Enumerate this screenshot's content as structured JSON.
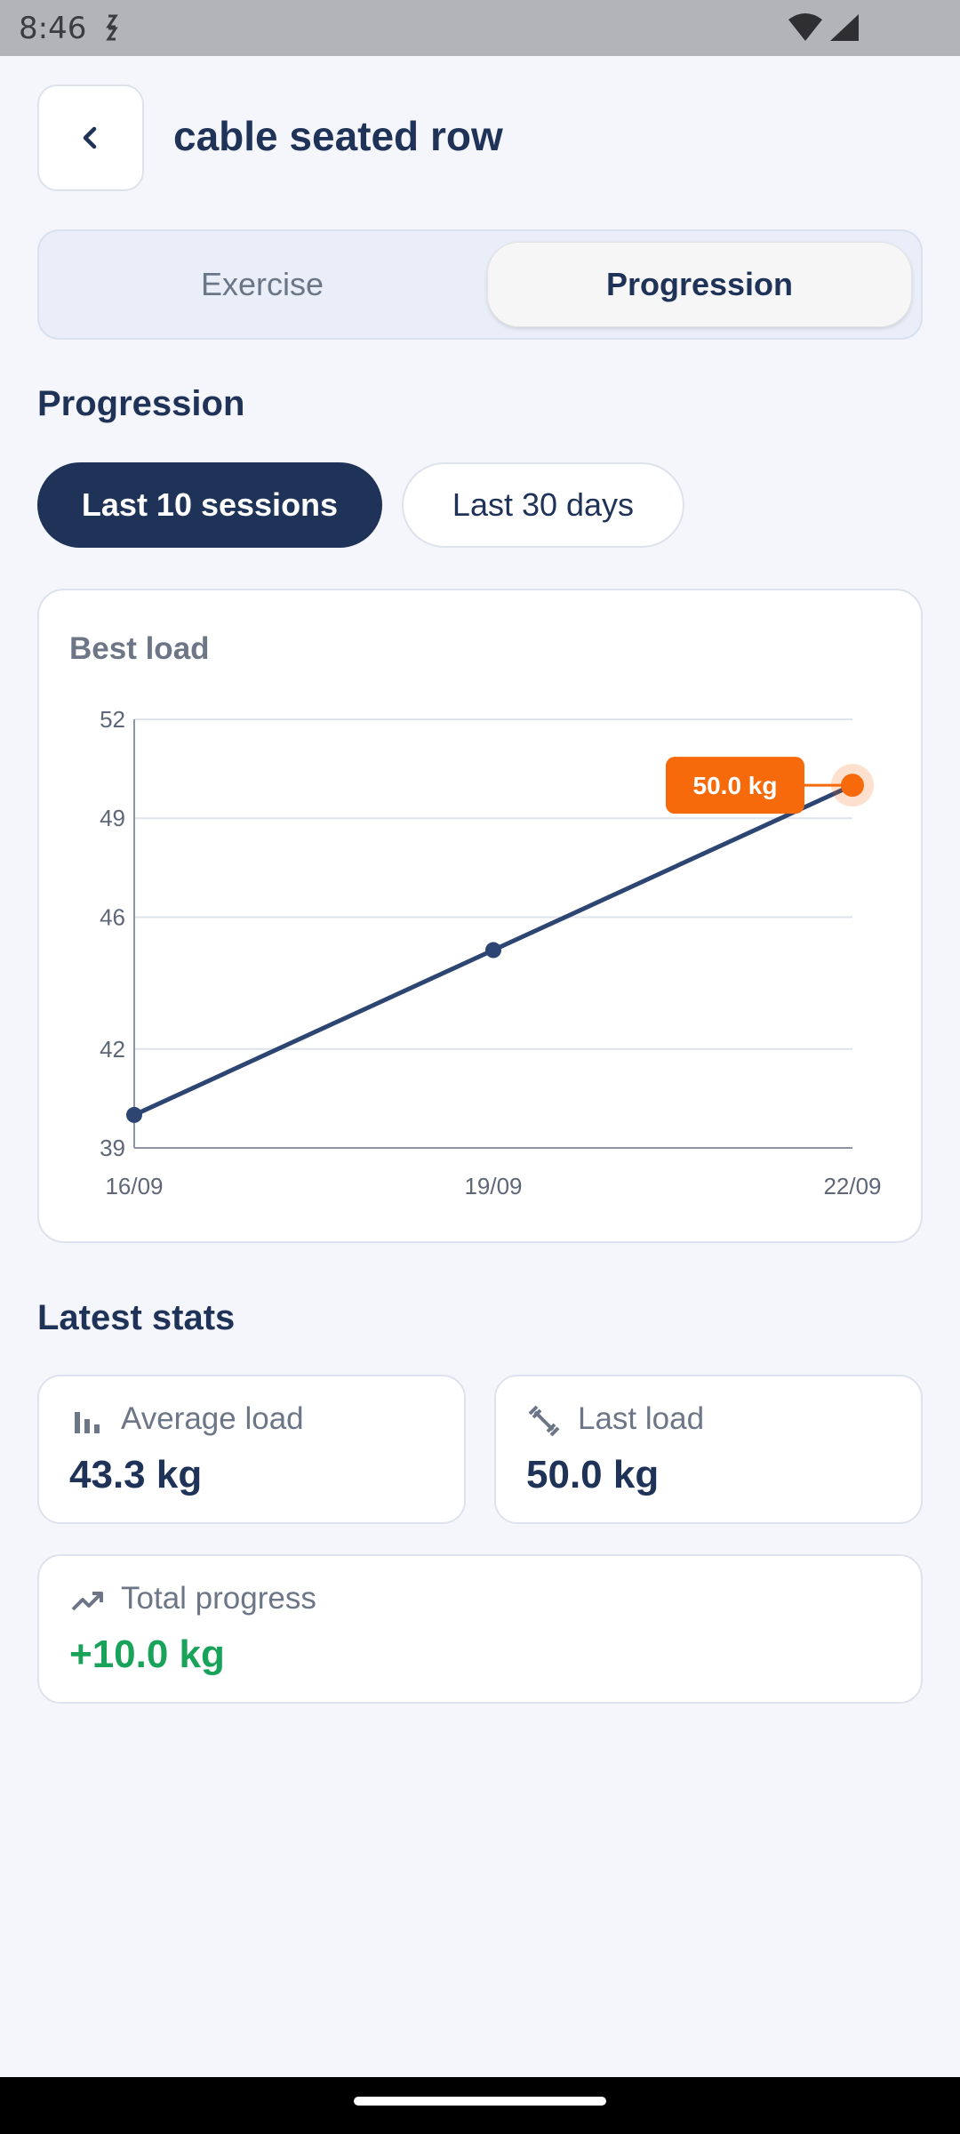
{
  "status_bar": {
    "time": "8:46"
  },
  "header": {
    "title": "cable seated row"
  },
  "tabs": [
    {
      "label": "Exercise",
      "selected": false
    },
    {
      "label": "Progression",
      "selected": true
    }
  ],
  "progression": {
    "section_title": "Progression",
    "filters": [
      {
        "label": "Last 10 sessions",
        "selected": true
      },
      {
        "label": "Last 30 days",
        "selected": false
      }
    ]
  },
  "chart_card": {
    "title": "Best load"
  },
  "chart_data": {
    "type": "line",
    "title": "Best load",
    "x": [
      "16/09",
      "19/09",
      "22/09"
    ],
    "series": [
      {
        "values": [
          40.0,
          45.0,
          50.0
        ]
      }
    ],
    "yticks": [
      39,
      42,
      46,
      49,
      52
    ],
    "ylim": [
      39,
      52
    ],
    "grid": true,
    "highlight": {
      "index": 2,
      "label": "50.0 kg"
    },
    "colors": {
      "line": "#2d4573",
      "highlight": "#f76a0c",
      "grid": "#dfe3ec",
      "axis": "#8e94a3"
    }
  },
  "latest_stats": {
    "section_title": "Latest stats",
    "average": {
      "label": "Average load",
      "value": "43.3 kg",
      "icon": "bar-chart-icon"
    },
    "last": {
      "label": "Last load",
      "value": "50.0 kg",
      "icon": "dumbbell-icon"
    },
    "total": {
      "label": "Total progress",
      "value": "+10.0 kg",
      "icon": "trending-up-icon",
      "color": "#19a35a"
    }
  }
}
